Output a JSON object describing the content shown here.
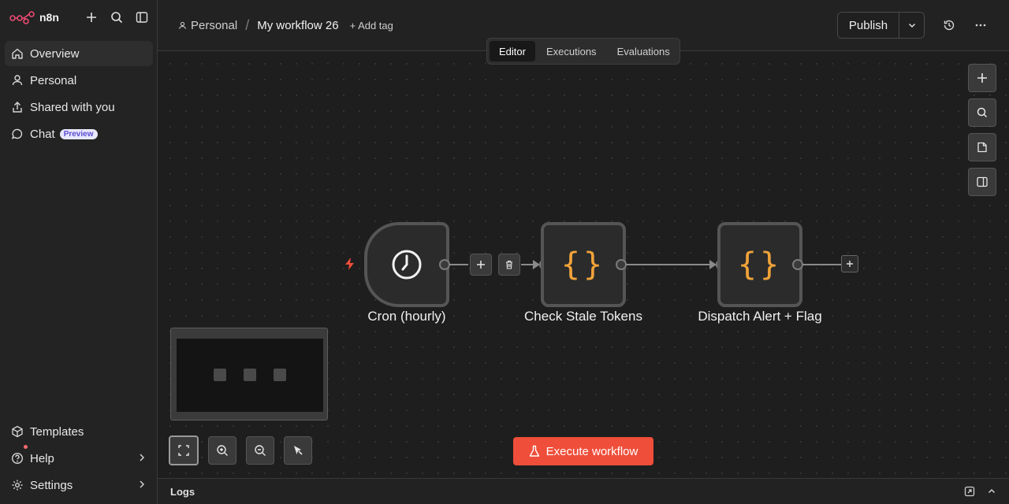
{
  "brand": {
    "name": "n8n"
  },
  "sidebar": {
    "items": [
      {
        "label": "Overview"
      },
      {
        "label": "Personal"
      },
      {
        "label": "Shared with you"
      },
      {
        "label": "Chat",
        "badge": "Preview"
      }
    ],
    "bottom": [
      {
        "label": "Templates"
      },
      {
        "label": "Help"
      },
      {
        "label": "Settings"
      }
    ]
  },
  "header": {
    "project": "Personal",
    "workflow_name": "My workflow 26",
    "add_tag": "+ Add tag",
    "publish": "Publish"
  },
  "tabs": [
    {
      "label": "Editor"
    },
    {
      "label": "Executions"
    },
    {
      "label": "Evaluations"
    }
  ],
  "nodes": [
    {
      "label": "Cron (hourly)"
    },
    {
      "label": "Check Stale Tokens"
    },
    {
      "label": "Dispatch Alert + Flag"
    }
  ],
  "canvas": {
    "execute_label": "Execute workflow"
  },
  "logs": {
    "title": "Logs"
  },
  "colors": {
    "accent": "#ef4e3a",
    "code_icon": "#f2a33a"
  }
}
